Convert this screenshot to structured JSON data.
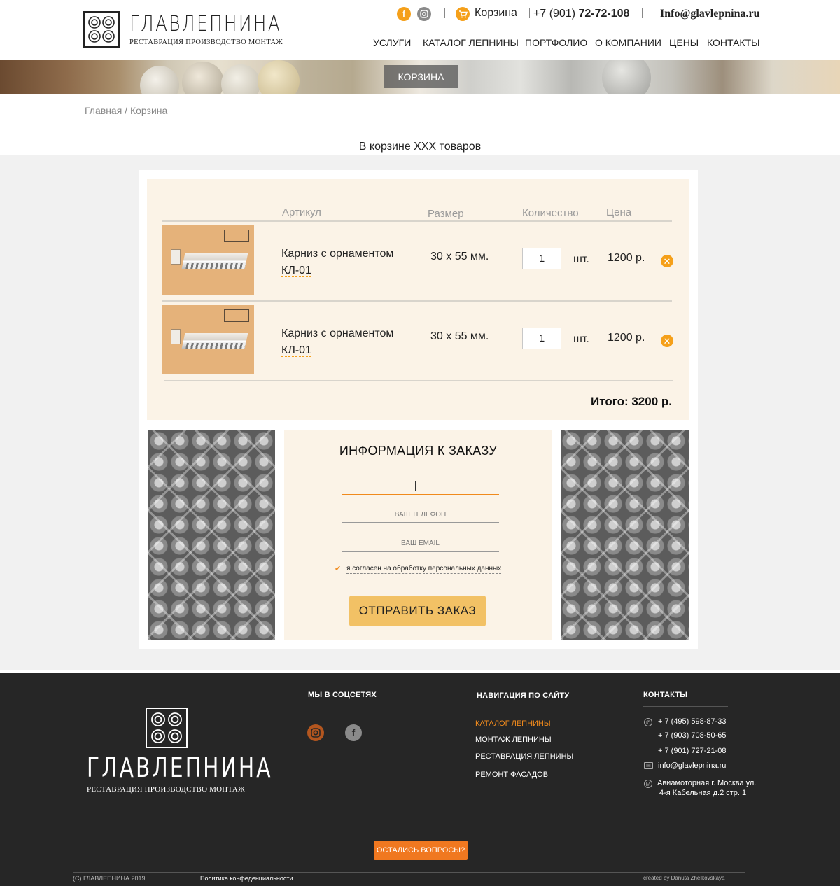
{
  "header": {
    "brand_name": "ГЛАВЛЕПНИНА",
    "brand_tagline": "РЕСТАВРАЦИЯ ПРОИЗВОДСТВО МОНТАЖ",
    "cart_label": "Корзина",
    "phone_prefix": "+7 (901)",
    "phone_number": "72-72-108",
    "email": "Info@glavlepnina.ru",
    "nav": [
      "УСЛУГИ",
      "КАТАЛОГ ЛЕПНИНЫ",
      "ПОРТФОЛИО",
      "О КОМПАНИИ",
      "ЦЕНЫ",
      "КОНТАКТЫ"
    ]
  },
  "banner": {
    "tab_label": "КОРЗИНА"
  },
  "breadcrumb": "Главная / Корзина",
  "cart_summary": "В корзине XXX товаров",
  "table": {
    "headers": {
      "article": "Артикул",
      "size": "Размер",
      "quantity": "Количество",
      "price": "Цена"
    },
    "rows": [
      {
        "name": "Карниз с орнаментом",
        "code": "КЛ-01",
        "size": "30 х 55 мм.",
        "qty": "1",
        "unit": "шт.",
        "price": "1200 р."
      },
      {
        "name": "Карниз с орнаментом",
        "code": "КЛ-01",
        "size": "30 х 55 мм.",
        "qty": "1",
        "unit": "шт.",
        "price": "1200 р."
      }
    ],
    "total": "Итого: 3200 р."
  },
  "order_form": {
    "title": "ИНФОРМАЦИЯ К ЗАКАЗУ",
    "name_value": "",
    "phone_placeholder": "ВАШ ТЕЛЕФОН",
    "email_placeholder": "ВАШ EMAIL",
    "consent": "я согласен на обработку персональных данных",
    "submit_label": "ОТПРАВИТЬ ЗАКАЗ"
  },
  "footer": {
    "brand_name": "ГЛАВЛЕПНИНА",
    "brand_tagline": "РЕСТАВРАЦИЯ ПРОИЗВОДСТВО МОНТАЖ",
    "social_heading": "МЫ В СОЦСЕТЯХ",
    "nav_heading": "НАВИГАЦИЯ ПО САЙТУ",
    "nav_items": [
      "КАТАЛОГ ЛЕПНИНЫ",
      "МОНТАЖ ЛЕПНИНЫ",
      "РЕСТАВРАЦИЯ ЛЕПНИНЫ",
      "РЕМОНТ ФАСАДОВ"
    ],
    "contacts_heading": "КОНТАКТЫ",
    "phones": [
      "+ 7 (495) 598-87-33",
      "+ 7 (903) 708-50-65",
      "+ 7 (901) 727-21-08"
    ],
    "email": "info@glavlepnina.ru",
    "address_line1": "Авиамоторная г. Москва ул.",
    "address_line2": "4-я Кабельная д.2 стр. 1",
    "ask_button": "ОСТАЛИСЬ ВОПРОСЫ?",
    "copyright": "(С) ГЛАВЛЕПНИНА 2019",
    "privacy": "Политика конфеденциальности",
    "credits": "created by Danuta Zhelkovskaya"
  },
  "colors": {
    "accent": "#f5a01a",
    "orange": "#f08a1c",
    "cream": "#fbf3e7",
    "footer_bg": "#262626",
    "button": "#f2c165"
  }
}
